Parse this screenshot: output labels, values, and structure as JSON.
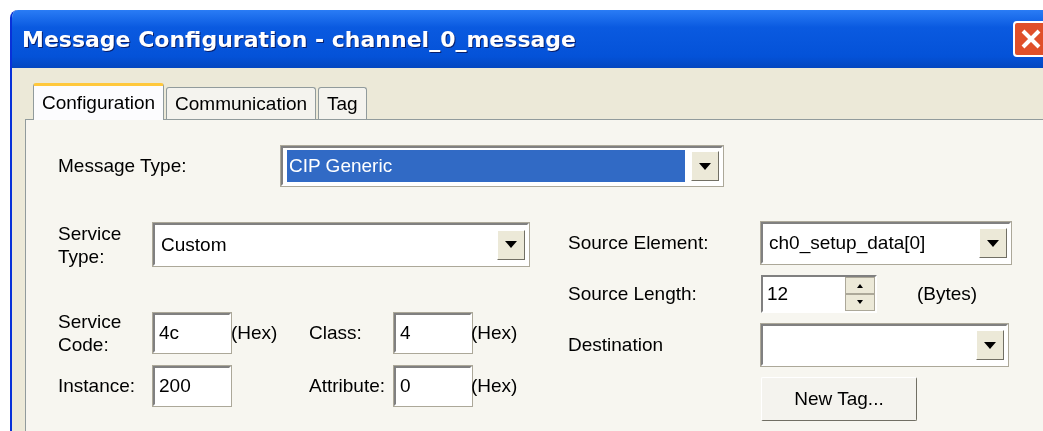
{
  "window": {
    "title": "Message Configuration - channel_0_message"
  },
  "tabs": [
    {
      "label": "Configuration",
      "selected": true
    },
    {
      "label": "Communication",
      "selected": false
    },
    {
      "label": "Tag",
      "selected": false
    }
  ],
  "message_type": {
    "label": "Message Type:",
    "value": "CIP Generic",
    "highlighted": true
  },
  "service_type": {
    "label": "Service Type:",
    "value": "Custom"
  },
  "service_code": {
    "label": "Service Code:",
    "value": "4c",
    "unit": "(Hex)"
  },
  "class": {
    "label": "Class:",
    "value": "4",
    "unit": "(Hex)"
  },
  "instance": {
    "label": "Instance:",
    "value": "200"
  },
  "attribute": {
    "label": "Attribute:",
    "value": "0",
    "unit": "(Hex)"
  },
  "source_element": {
    "label": "Source Element:",
    "value": "ch0_setup_data[0]"
  },
  "source_length": {
    "label": "Source Length:",
    "value": "12",
    "unit": "(Bytes)"
  },
  "destination": {
    "label": "Destination"
  },
  "new_tag_button": "New Tag..."
}
